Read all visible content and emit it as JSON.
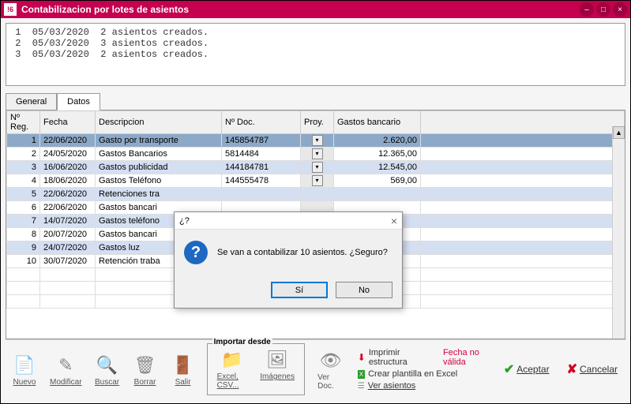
{
  "window": {
    "icon_text": "!6",
    "title": "Contabilizacion por lotes de asientos"
  },
  "log": [
    {
      "n": "1",
      "date": "05/03/2020",
      "msg": "2 asientos creados."
    },
    {
      "n": "2",
      "date": "05/03/2020",
      "msg": "3 asientos creados."
    },
    {
      "n": "3",
      "date": "05/03/2020",
      "msg": "2 asientos creados."
    }
  ],
  "tabs": {
    "general": "General",
    "datos": "Datos"
  },
  "columns": {
    "nreg": "Nº Reg.",
    "fecha": "Fecha",
    "descripcion": "Descripcion",
    "ndoc": "Nº Doc.",
    "proy": "Proy.",
    "gastos": "Gastos bancario"
  },
  "rows": [
    {
      "n": "1",
      "fecha": "22/06/2020",
      "desc": "Gasto por transporte",
      "doc": "145854787",
      "gastos": "2.620,00",
      "cls": "blue highlight"
    },
    {
      "n": "2",
      "fecha": "24/05/2020",
      "desc": "Gastos Bancarios",
      "doc": "5814484",
      "gastos": "12.365,00",
      "cls": ""
    },
    {
      "n": "3",
      "fecha": "16/06/2020",
      "desc": "Gastos publicidad",
      "doc": "144184781",
      "gastos": "12.545,00",
      "cls": "blue"
    },
    {
      "n": "4",
      "fecha": "18/06/2020",
      "desc": "Gastos Teléfono",
      "doc": "144555478",
      "gastos": "569,00",
      "cls": ""
    },
    {
      "n": "5",
      "fecha": "22/06/2020",
      "desc": "Retenciones tra",
      "doc": "",
      "gastos": "",
      "cls": "blue"
    },
    {
      "n": "6",
      "fecha": "22/06/2020",
      "desc": "Gastos bancari",
      "doc": "",
      "gastos": "",
      "cls": ""
    },
    {
      "n": "7",
      "fecha": "14/07/2020",
      "desc": "Gastos teléfono",
      "doc": "",
      "gastos": "",
      "cls": "blue"
    },
    {
      "n": "8",
      "fecha": "20/07/2020",
      "desc": "Gastos bancari",
      "doc": "",
      "gastos": "",
      "cls": ""
    },
    {
      "n": "9",
      "fecha": "24/07/2020",
      "desc": "Gastos luz",
      "doc": "",
      "gastos": "",
      "cls": "blue"
    },
    {
      "n": "10",
      "fecha": "30/07/2020",
      "desc": "Retención traba",
      "doc": "",
      "gastos": "",
      "cls": ""
    }
  ],
  "toolbar": {
    "nuevo": "Nuevo",
    "modificar": "Modificar",
    "buscar": "Buscar",
    "borrar": "Borrar",
    "salir": "Salir",
    "importar_legend": "Importar desde",
    "excel_csv": "Excel, CSV...",
    "imagenes": "Imágenes",
    "ver_doc": "Ver Doc."
  },
  "links": {
    "imprimir": "Imprimir estructura",
    "fecha_invalida": "Fecha no válida",
    "crear_plantilla": "Crear plantilla en Excel",
    "ver_asientos": "Ver asientos"
  },
  "actions": {
    "aceptar": "Aceptar",
    "cancelar": "Cancelar"
  },
  "dialog": {
    "title": "¿?",
    "message": "Se van a contabilizar 10 asientos. ¿Seguro?",
    "yes": "Sí",
    "no": "No"
  }
}
